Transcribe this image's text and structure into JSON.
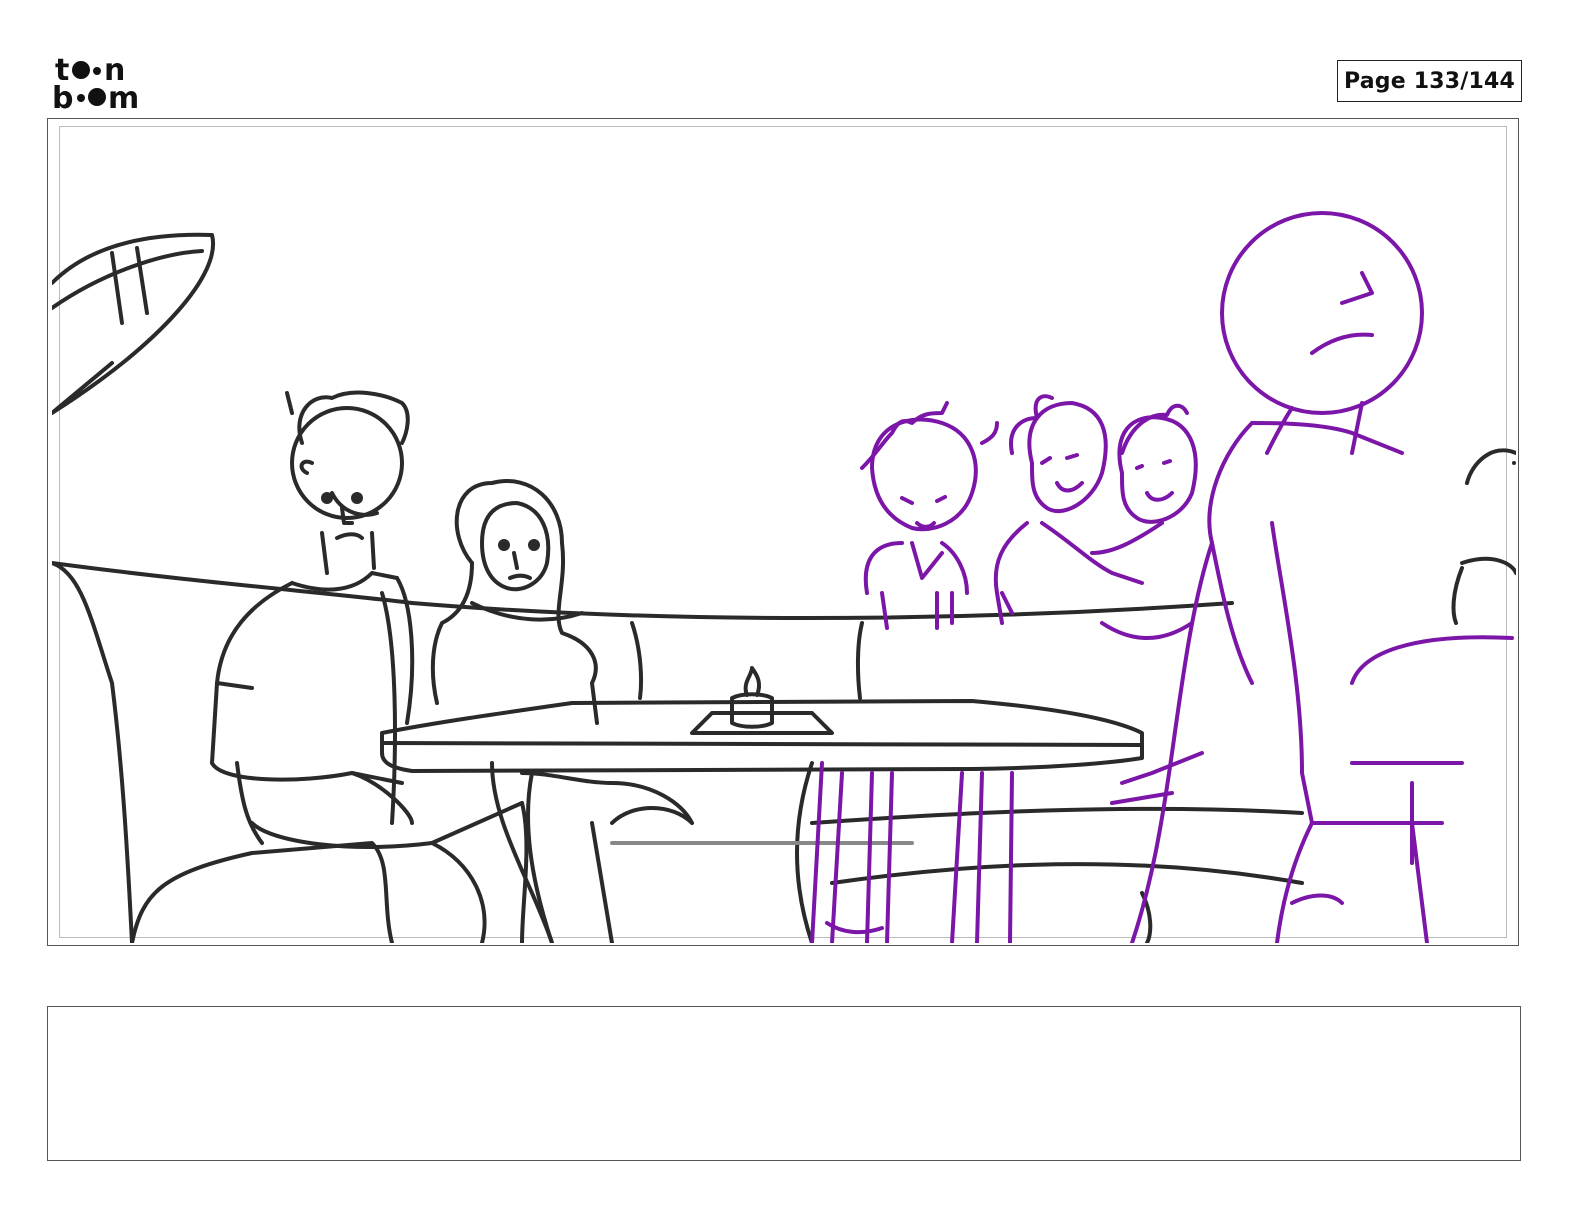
{
  "header": {
    "logo_text": "toon boom",
    "page_label": "Page 133/144"
  },
  "panel": {
    "scene": "storyboard-panel",
    "cleanup_line_color": "#222222",
    "rough_line_color": "#7B16A8"
  },
  "caption": {
    "text": ""
  }
}
